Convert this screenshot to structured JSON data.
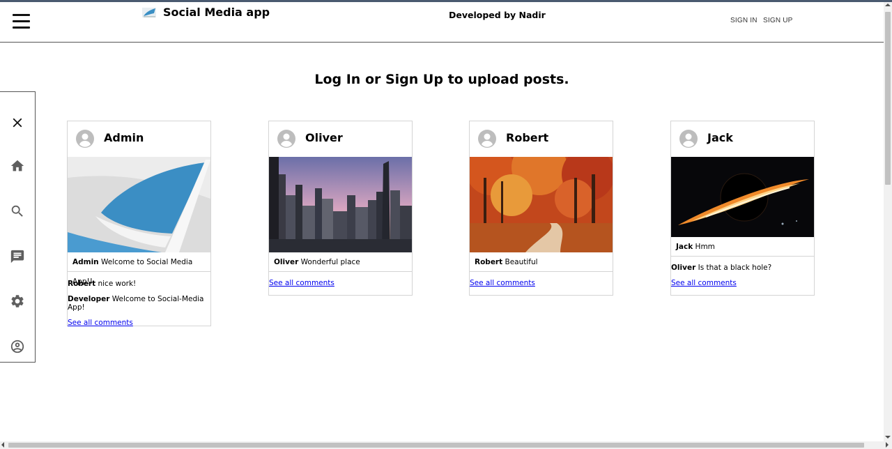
{
  "header": {
    "app_title": "Social Media app",
    "developer": "Developed by Nadir",
    "sign_in": "SIGN IN",
    "sign_up": "SIGN UP"
  },
  "main": {
    "heading": "Log In or Sign Up to upload posts."
  },
  "sidebar": {
    "icons": [
      "close-icon",
      "home-icon",
      "search-icon",
      "chat-icon",
      "settings-icon",
      "account-icon"
    ]
  },
  "posts": [
    {
      "username": "Admin",
      "caption_user": "Admin",
      "caption_text": "Welcome to Social Media App!!",
      "comments": [
        {
          "user": "Robert",
          "text": "nice work!"
        },
        {
          "user": "Developer",
          "text": "Welcome to Social-Media App!"
        }
      ],
      "see_all": "See all comments"
    },
    {
      "username": "Oliver",
      "caption_user": "Oliver",
      "caption_text": "Wonderful place",
      "comments": [],
      "see_all": "See all comments"
    },
    {
      "username": "Robert",
      "caption_user": "Robert",
      "caption_text": "Beautiful",
      "comments": [],
      "see_all": "See all comments"
    },
    {
      "username": "Jack",
      "caption_user": "Jack",
      "caption_text": "Hmm",
      "comments": [
        {
          "user": "Oliver",
          "text": "Is that a black hole?"
        }
      ],
      "see_all": "See all comments"
    }
  ],
  "colors": {
    "link": "#0000ee",
    "icon_gray": "#5f5f5f",
    "border": "#d4d4d4"
  }
}
